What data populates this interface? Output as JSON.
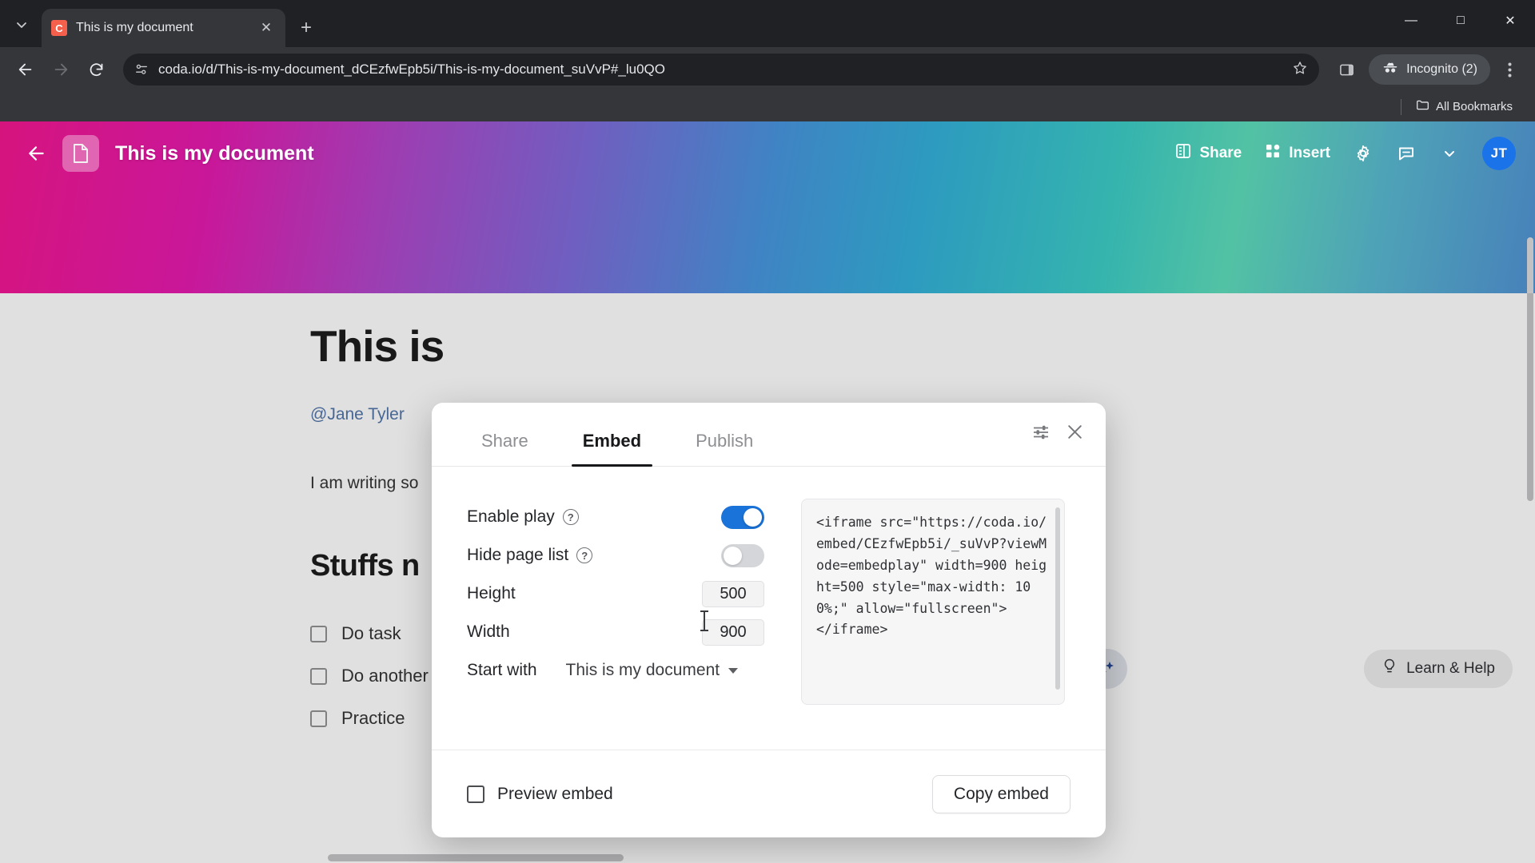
{
  "browser": {
    "tab": {
      "title": "This is my document",
      "favicon_label": "C",
      "favicon_color": "#f4604c"
    },
    "new_tab_label": "+",
    "window_controls": {
      "minimize": "—",
      "maximize": "□",
      "close": "✕"
    },
    "omnibox": {
      "url": "coda.io/d/This-is-my-document_dCEzfwEpb5i/This-is-my-document_suVvP#_lu0QO",
      "site_icon": "site-settings-icon",
      "bookmark_icon": "star-icon"
    },
    "side_panel_icon": "side-panel-icon",
    "profile": {
      "label": "Incognito (2)",
      "icon": "incognito-icon"
    },
    "menu_icon": "three-dot-menu-icon",
    "bookmarks_bar": {
      "all_bookmarks_label": "All Bookmarks",
      "folder_icon": "folder-icon"
    },
    "nav": {
      "back": "←",
      "forward": "→",
      "reload": "↻"
    }
  },
  "doc": {
    "title": "This is my document",
    "doc_icon": "document-page-icon",
    "back_icon": "back-arrow-icon",
    "actions": {
      "share": "Share",
      "insert": "Insert",
      "settings_icon": "gear-icon",
      "comment_icon": "comment-icon",
      "chevron_icon": "chevron-down-icon"
    },
    "avatar_initials": "JT",
    "sidebar_expand_icon": "»",
    "right_collapse_icon": "«",
    "heading1": "This is",
    "mention": "@Jane Tyler",
    "paragraph": "I am writing so",
    "heading2": "Stuffs n",
    "tasks": [
      "Do task",
      "Do another task",
      "Practice"
    ],
    "ai_icon": "sparkle-icon",
    "help": {
      "label": "Learn & Help",
      "icon": "lightbulb-icon"
    }
  },
  "modal": {
    "tabs": [
      {
        "label": "Share",
        "active": false
      },
      {
        "label": "Embed",
        "active": true
      },
      {
        "label": "Publish",
        "active": false
      }
    ],
    "settings_icon": "sliders-icon",
    "close_icon": "close-icon",
    "settings": {
      "enable_play": {
        "label": "Enable play",
        "help_icon": "question-mark-icon",
        "value": "on"
      },
      "hide_page_list": {
        "label": "Hide page list",
        "help_icon": "question-mark-icon",
        "value": "off"
      },
      "height": {
        "label": "Height",
        "value": "500"
      },
      "width": {
        "label": "Width",
        "value": "900"
      },
      "start_with": {
        "label": "Start with",
        "value": "This is my document",
        "caret_icon": "caret-down-icon"
      }
    },
    "embed_code": "<iframe src=\"https://coda.io/embed/CEzfwEpb5i/_suVvP?viewMode=embedplay\" width=900 height=500 style=\"max-width: 100%;\" allow=\"fullscreen\">\n</iframe>",
    "footer": {
      "preview_label": "Preview embed",
      "preview_checked": false,
      "copy_label": "Copy embed"
    }
  },
  "colors": {
    "accent_blue": "#1a73d9",
    "avatar_blue": "#1a73e8",
    "chrome_dark": "#202124",
    "tab_active": "#35363a"
  }
}
